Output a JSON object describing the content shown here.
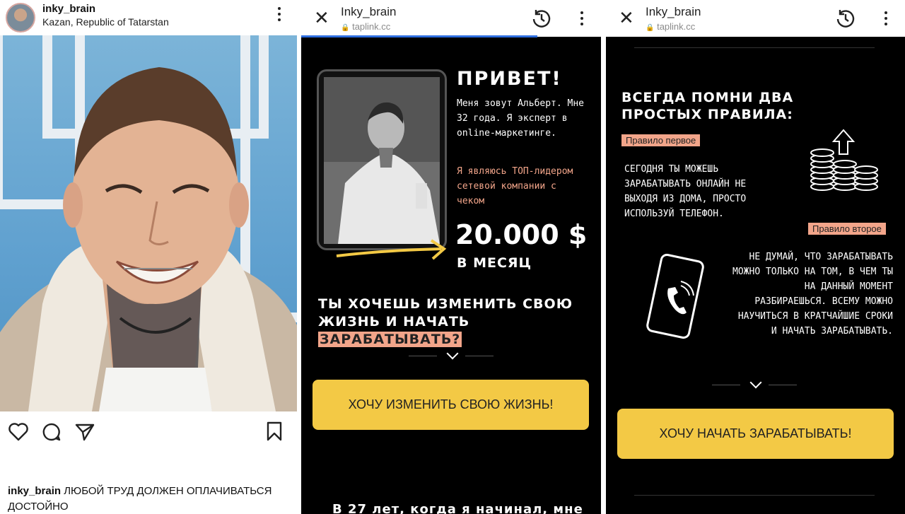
{
  "instagram": {
    "username": "inky_brain",
    "location": "Kazan, Republic of Tatarstan",
    "caption_user": "inky_brain",
    "caption_text": "ЛЮБОЙ ТРУД ДОЛЖЕН ОПЛАЧИВАТЬСЯ ДОСТОЙНО"
  },
  "browser": {
    "title": "Inky_brain",
    "url": "taplink.cc"
  },
  "page1": {
    "greeting": "ПРИВЕТ!",
    "intro": "Меня зовут Альберт. Мне 32 года. Я эксперт в online-маркетинге.",
    "leader": "Я являюсь ТОП-лидером сетевой компании с чеком",
    "amount": "20.000 $",
    "period": "В МЕСЯЦ",
    "question_main": "ТЫ ХОЧЕШЬ ИЗМЕНИТЬ СВОЮ ЖИЗНЬ И НАЧАТЬ",
    "question_highlight": "ЗАРАБАТЫВАТЬ?",
    "cta": "ХОЧУ ИЗМЕНИТЬ СВОЮ ЖИЗНЬ!",
    "cutoff_text": "В 27 лет, когда я начинал, мне"
  },
  "page2": {
    "heading": "ВСЕГДА ПОМНИ ДВА ПРОСТЫХ ПРАВИЛА:",
    "rule1_label": "Правило первое",
    "rule1_text": "СЕГОДНЯ ТЫ МОЖЕШЬ ЗАРАБАТЫВАТЬ ОНЛАЙН НЕ ВЫХОДЯ ИЗ ДОМА, ПРОСТО ИСПОЛЬЗУЙ ТЕЛЕФОН.",
    "rule2_label": "Правило второе",
    "rule2_text": "НЕ ДУМАЙ, ЧТО ЗАРАБАТЫВАТЬ МОЖНО ТОЛЬКО НА ТОМ, В ЧЕМ ТЫ НА ДАННЫЙ МОМЕНТ РАЗБИРАЕШЬСЯ. ВСЕМУ МОЖНО НАУЧИТЬСЯ В КРАТЧАЙШИЕ СРОКИ И НАЧАТЬ ЗАРАБАТЫВАТЬ.",
    "cta": "ХОЧУ НАЧАТЬ ЗАРАБАТЫВАТЬ!"
  },
  "colors": {
    "accent": "#f3c945",
    "highlight": "#f2a58a",
    "background": "#000000",
    "progress": "#2f6fe0"
  },
  "icons": [
    "heart-icon",
    "comment-icon",
    "share-icon",
    "bookmark-icon",
    "close-icon",
    "history-icon",
    "more-icon",
    "lock-icon",
    "chevron-down-icon",
    "coins-icon",
    "phone-icon"
  ]
}
